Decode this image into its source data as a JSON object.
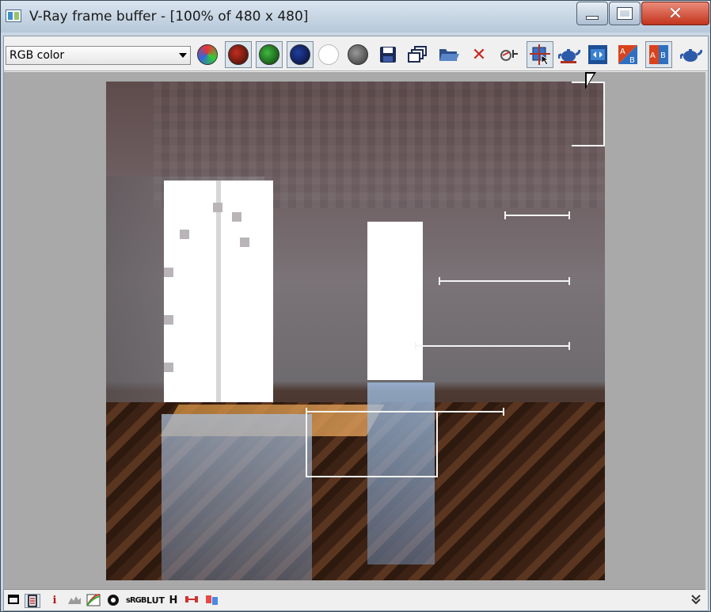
{
  "window": {
    "title": "V-Ray frame buffer - [100% of 480 x 480]",
    "minimize_icon": "minimize-icon",
    "maximize_icon": "maximize-icon",
    "close_icon": "close-icon"
  },
  "toolbar": {
    "channel_select": {
      "value": "RGB color",
      "icon": "chevron-down-icon"
    },
    "buttons": [
      {
        "name": "switch-to-rgb",
        "icon": "rgb-channels-icon"
      },
      {
        "name": "view-red-channel",
        "icon": "red-dot-icon",
        "pressed": true
      },
      {
        "name": "view-green-channel",
        "icon": "green-dot-icon",
        "pressed": true
      },
      {
        "name": "view-blue-channel",
        "icon": "blue-dot-icon",
        "pressed": true
      },
      {
        "name": "view-alpha-channel",
        "icon": "white-dot-icon"
      },
      {
        "name": "monochrome-mode",
        "icon": "gray-dot-icon"
      },
      {
        "name": "save-image",
        "icon": "floppy-disk-icon"
      },
      {
        "name": "clone-frame-buffer",
        "icon": "clone-windows-icon"
      },
      {
        "name": "load-image",
        "icon": "folder-open-icon"
      },
      {
        "name": "clear-image",
        "icon": "red-x-icon"
      },
      {
        "name": "track-mouse",
        "icon": "track-mouse-icon"
      },
      {
        "name": "region-render",
        "icon": "region-render-icon",
        "pressed": true
      },
      {
        "name": "render-last",
        "icon": "teapot-icon"
      },
      {
        "name": "link-to-vfb",
        "icon": "link-icon"
      },
      {
        "name": "compare-a",
        "icon": "ab-compare-icon"
      },
      {
        "name": "compare-b",
        "icon": "ab-compare-pressed-icon",
        "pressed": true
      },
      {
        "name": "render",
        "icon": "teapot-render-icon"
      }
    ]
  },
  "statusbar": {
    "buttons": [
      {
        "name": "display-correction",
        "icon": "window-icon",
        "label": ""
      },
      {
        "name": "color-corrections",
        "icon": "list-icon",
        "label": "",
        "pressed": true
      },
      {
        "name": "pixel-info",
        "icon": "info-icon",
        "label": "i"
      },
      {
        "name": "levels",
        "icon": "levels-icon",
        "label": ""
      },
      {
        "name": "curves",
        "icon": "curves-icon",
        "label": ""
      },
      {
        "name": "exposure",
        "icon": "exposure-icon",
        "label": ""
      },
      {
        "name": "srgb",
        "icon": "srgb-icon",
        "label": "sRGB"
      },
      {
        "name": "lut",
        "icon": "lut-icon",
        "label": "LUT"
      },
      {
        "name": "histogram",
        "icon": "histogram-icon",
        "label": "H"
      },
      {
        "name": "stereo",
        "icon": "stereo-icon",
        "label": ""
      },
      {
        "name": "ocio",
        "icon": "ocio-icon",
        "label": ""
      }
    ],
    "expand_icon": "double-chevron-down-icon"
  }
}
